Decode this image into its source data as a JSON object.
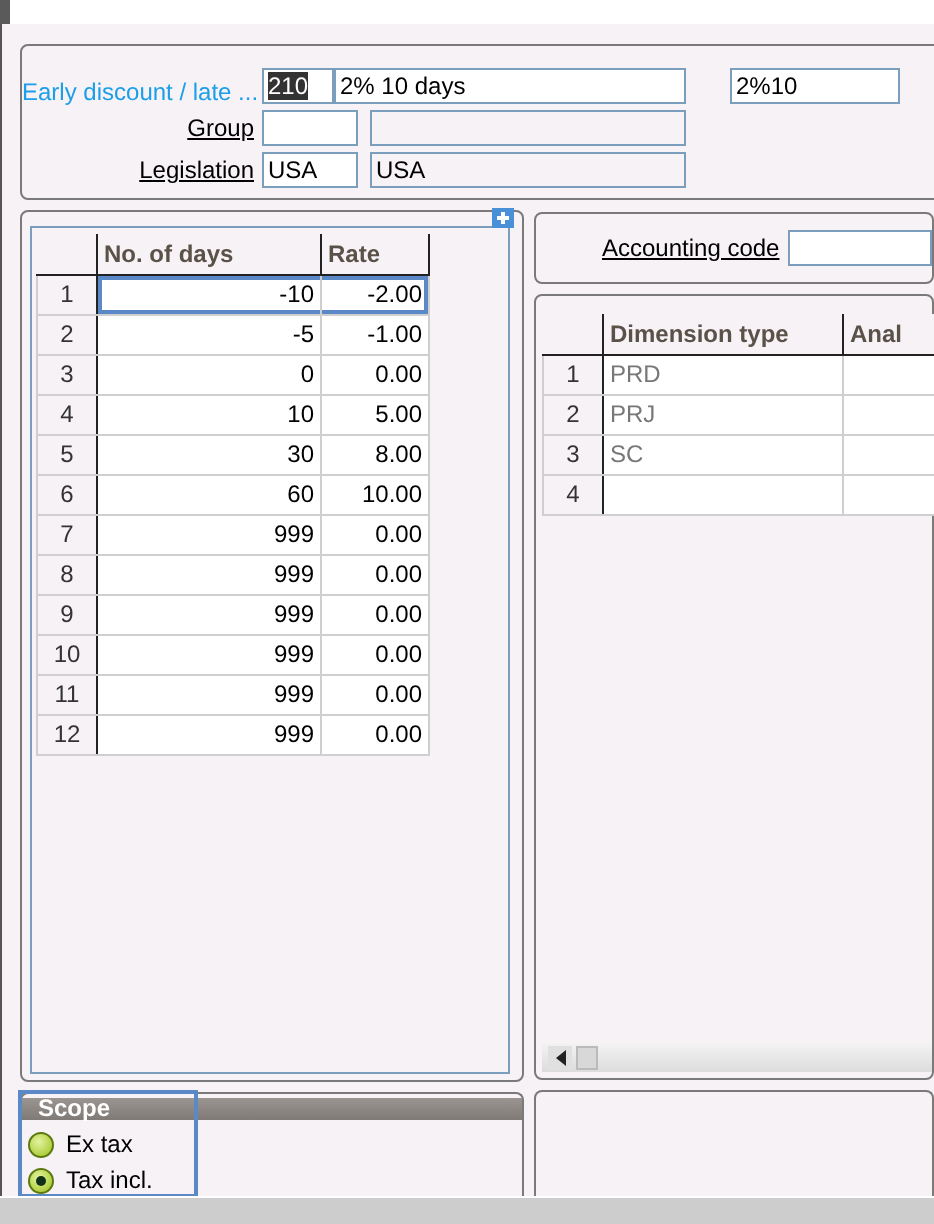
{
  "header": {
    "label": "Early discount / late ...",
    "code": "210",
    "description": "2% 10 days",
    "short_name": "2%10",
    "group": {
      "label": "Group"
    },
    "legislation": {
      "label": "Legislation",
      "code": "USA",
      "description": "USA"
    }
  },
  "rates_table": {
    "columns": [
      "No. of days",
      "Rate"
    ],
    "rows": [
      {
        "index": "1",
        "days": "-10",
        "rate": "-2.00",
        "selected": true
      },
      {
        "index": "2",
        "days": "-5",
        "rate": "-1.00",
        "selected": false
      },
      {
        "index": "3",
        "days": "0",
        "rate": "0.00",
        "selected": false
      },
      {
        "index": "4",
        "days": "10",
        "rate": "5.00",
        "selected": false
      },
      {
        "index": "5",
        "days": "30",
        "rate": "8.00",
        "selected": false
      },
      {
        "index": "6",
        "days": "60",
        "rate": "10.00",
        "selected": false
      },
      {
        "index": "7",
        "days": "999",
        "rate": "0.00",
        "selected": false
      },
      {
        "index": "8",
        "days": "999",
        "rate": "0.00",
        "selected": false
      },
      {
        "index": "9",
        "days": "999",
        "rate": "0.00",
        "selected": false
      },
      {
        "index": "10",
        "days": "999",
        "rate": "0.00",
        "selected": false
      },
      {
        "index": "11",
        "days": "999",
        "rate": "0.00",
        "selected": false
      },
      {
        "index": "12",
        "days": "999",
        "rate": "0.00",
        "selected": false
      }
    ]
  },
  "accounting_code": {
    "label": "Accounting code"
  },
  "dimensions_table": {
    "columns": [
      "Dimension type",
      "Anal"
    ],
    "rows": [
      {
        "index": "1",
        "type": "PRD"
      },
      {
        "index": "2",
        "type": "PRJ"
      },
      {
        "index": "3",
        "type": "SC"
      },
      {
        "index": "4",
        "type": ""
      }
    ]
  },
  "scope": {
    "title": "Scope",
    "options": [
      {
        "label": "Ex tax",
        "selected": false
      },
      {
        "label": "Tax incl.",
        "selected": true
      }
    ]
  }
}
